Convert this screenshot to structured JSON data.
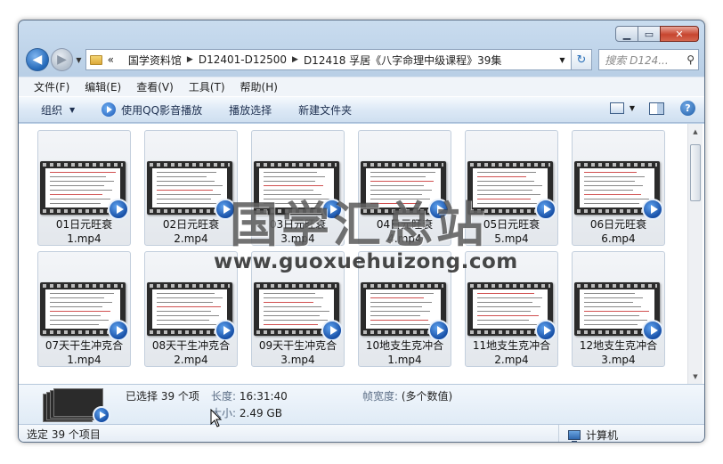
{
  "window": {
    "caption_min": "▁",
    "caption_max": "▭",
    "caption_close": "✕"
  },
  "nav": {
    "back_glyph": "◀",
    "forward_glyph": "▶",
    "breadcrumb_overflow": "«",
    "breadcrumbs": [
      "国学资料馆",
      "D12401-D12500",
      "D12418 孚居《八字命理中级课程》39集"
    ],
    "refresh_glyph": "↻",
    "search_placeholder": "搜索 D124...",
    "search_icon_glyph": "⚲"
  },
  "menu": [
    "文件(F)",
    "编辑(E)",
    "查看(V)",
    "工具(T)",
    "帮助(H)"
  ],
  "commands": {
    "organize": "组织",
    "play_qq": "使用QQ影音播放",
    "play_select": "播放选择",
    "new_folder": "新建文件夹",
    "help_glyph": "?"
  },
  "files": [
    {
      "line1": "01日元旺衰",
      "line2": "1.mp4"
    },
    {
      "line1": "02日元旺衰",
      "line2": "2.mp4"
    },
    {
      "line1": "03日元旺衰",
      "line2": "3.mp4"
    },
    {
      "line1": "04日元旺衰",
      "line2": "4.mp4"
    },
    {
      "line1": "05日元旺衰",
      "line2": "5.mp4"
    },
    {
      "line1": "06日元旺衰",
      "line2": "6.mp4"
    },
    {
      "line1": "07天干生冲克合",
      "line2": "1.mp4"
    },
    {
      "line1": "08天干生冲克合",
      "line2": "2.mp4"
    },
    {
      "line1": "09天干生冲克合",
      "line2": "3.mp4"
    },
    {
      "line1": "10地支生克冲合",
      "line2": "1.mp4"
    },
    {
      "line1": "11地支生克冲合",
      "line2": "2.mp4"
    },
    {
      "line1": "12地支生克冲合",
      "line2": "3.mp4"
    }
  ],
  "details": {
    "selected": "已选择 39 个项",
    "length_label": "长度:",
    "length_value": "16:31:40",
    "size_label": "大小:",
    "size_value": "2.49 GB",
    "framewidth_label": "帧宽度:",
    "framewidth_value": "(多个数值)"
  },
  "status": {
    "left": "选定 39 个项目",
    "right": "计算机"
  },
  "watermark": {
    "title": "国学汇总站",
    "url": "www.guoxuehuizong.com"
  },
  "colors": {
    "accent": "#1c58b5",
    "close": "#c7452f",
    "frame": "#b9cfe6"
  }
}
